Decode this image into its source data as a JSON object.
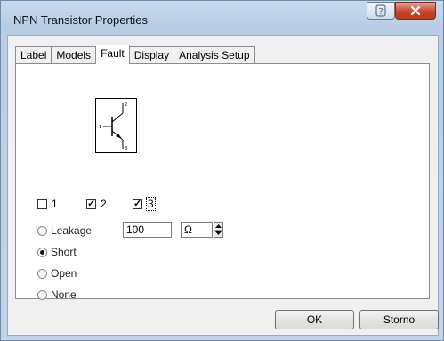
{
  "window": {
    "title": "NPN Transistor Properties"
  },
  "tabs": [
    {
      "label": "Label"
    },
    {
      "label": "Models"
    },
    {
      "label": "Fault"
    },
    {
      "label": "Display"
    },
    {
      "label": "Analysis Setup"
    }
  ],
  "active_tab": "Fault",
  "symbol": {
    "pins": [
      "1",
      "2",
      "3"
    ]
  },
  "checkboxes": [
    {
      "label": "1",
      "checked": false
    },
    {
      "label": "2",
      "checked": true
    },
    {
      "label": "3",
      "checked": true
    }
  ],
  "fault_options": [
    {
      "label": "Leakage",
      "selected": false
    },
    {
      "label": "Short",
      "selected": true
    },
    {
      "label": "Open",
      "selected": false
    },
    {
      "label": "None",
      "selected": false
    }
  ],
  "leakage": {
    "value": "100",
    "unit": "Ω"
  },
  "buttons": {
    "ok": "OK",
    "cancel": "Storno"
  },
  "icons": {
    "help": "help-icon",
    "close": "close-icon",
    "spin_up": "arrow-up-icon",
    "spin_down": "arrow-down-icon"
  }
}
